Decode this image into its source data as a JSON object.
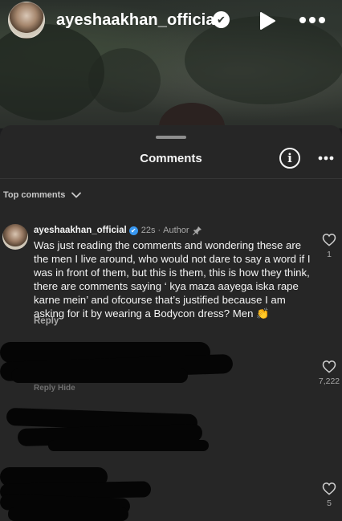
{
  "story": {
    "username": "ayeshaakhan_official",
    "verified_glyph": "✔",
    "icons": [
      "play-icon",
      "more-icon"
    ]
  },
  "sheet": {
    "title": "Comments",
    "info_glyph": "i",
    "sort_label": "Top comments"
  },
  "author_comment": {
    "username": "ayeshaakhan_official",
    "verified_glyph": "✔",
    "time": "22s",
    "separator": "·",
    "author_label": "Author",
    "text": "Was just reading the comments and wondering these are the men I live around, who would not dare to say a word if I was in front of them, but this is them, this is how they think, there are comments saying ‘ kya maza aayega iska rape karne mein’ and ofcourse that’s justified because I am asking for it by wearing a Bodycon dress? Men 👏",
    "reply_label": "Reply",
    "like_count": "1"
  },
  "redacted_comments": [
    {
      "faint_text": "Reply     Hide",
      "like_count": "7,222"
    },
    {
      "faint_text": "",
      "like_count": ""
    },
    {
      "faint_text": "",
      "like_count": "5"
    }
  ],
  "colors": {
    "sheet_bg": "#262626",
    "text_primary": "#f5f5f5",
    "text_secondary": "#a8a8a8",
    "verified_blue": "#3897f0",
    "redaction": "#050505"
  }
}
